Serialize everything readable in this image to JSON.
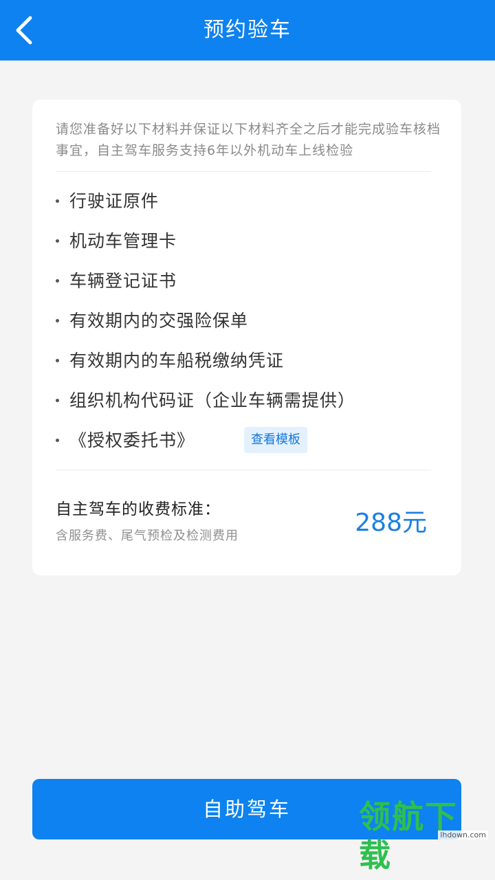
{
  "header": {
    "title": "预约验车",
    "back_icon": "chevron-left-icon"
  },
  "notice": {
    "text": "请您准备好以下材料并保证以下材料齐全之后才能完成验车核档事宜，自主驾车服务支持6年以外机动车上线检验"
  },
  "materials": {
    "items": [
      "行驶证原件",
      "机动车管理卡",
      "车辆登记证书",
      "有效期内的交强险保单",
      "有效期内的车船税缴纳凭证",
      "组织机构代码证（企业车辆需提供）",
      "《授权委托书》"
    ],
    "template_button": "查看模板"
  },
  "fee": {
    "title": "自主驾车的收费标准：",
    "subtitle": "含服务费、尾气预检及检测费用",
    "price": "288元"
  },
  "action": {
    "button_label": "自助驾车"
  },
  "watermark": {
    "text": "领航下载",
    "url": "lhdown.com"
  },
  "colors": {
    "primary": "#0d82f0",
    "background": "#f4f4f4",
    "price": "#1a7fe0",
    "watermark": "#2fbf4f"
  }
}
